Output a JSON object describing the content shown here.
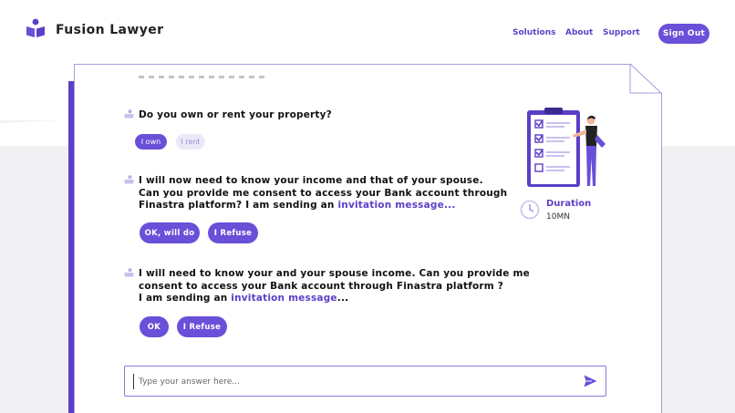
{
  "brand": {
    "name": "Fusion Lawyer"
  },
  "nav": {
    "solutions": "Solutions",
    "about": "About",
    "support": "Support",
    "sign_out": "Sign Out"
  },
  "conversation": {
    "q1": {
      "text": "Do you own or rent your property?",
      "options": [
        "I own",
        "I rent"
      ],
      "selected": "I own"
    },
    "q2": {
      "line1": "I will now need to know your income and that of your spouse.",
      "line2": "Can you provide me consent to access your Bank account through",
      "line3_pre": "Finastra platform? I am sending an ",
      "line3_link": "invitation message...",
      "buttons": [
        "OK, will do",
        "I Refuse"
      ]
    },
    "q3": {
      "line1": "I will need to know your and your spouse income. Can you provide me",
      "line2": "consent to access your Bank account through Finastra platform ?",
      "line3_pre": "I am sending an ",
      "line3_link": "invitation message",
      "line3_post": "...",
      "buttons": [
        "OK",
        "I Refuse"
      ]
    }
  },
  "duration": {
    "title": "Duration",
    "value": "10MN"
  },
  "answer": {
    "placeholder": "Type your answer here..."
  },
  "colors": {
    "accent": "#6a4fd8",
    "accent_dark": "#5b3fc6",
    "soft_pill": "#ece8f8"
  },
  "icons": {
    "logo": "reading-person-icon",
    "question": "bot-avatar-icon",
    "clock": "clock-icon",
    "send": "send-icon",
    "illustration": "checklist-illustration"
  }
}
